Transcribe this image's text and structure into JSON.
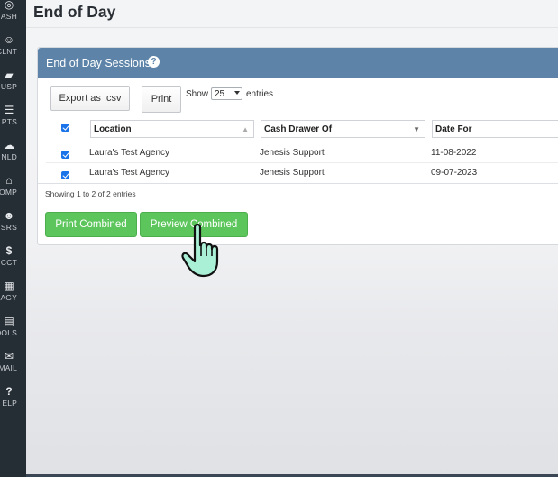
{
  "sidebar": {
    "items": [
      {
        "label": "ASH",
        "icon": "dashboard-icon",
        "glyph": "◎"
      },
      {
        "label": "CLNT",
        "icon": "smiley-icon",
        "glyph": "☺"
      },
      {
        "label": "USP",
        "icon": "note-icon",
        "glyph": "▰"
      },
      {
        "label": "PTS",
        "icon": "list-icon",
        "glyph": "☰"
      },
      {
        "label": "NLD",
        "icon": "cloud-download-icon",
        "glyph": "☁"
      },
      {
        "label": "OMP",
        "icon": "bank-icon",
        "glyph": "⌂"
      },
      {
        "label": "SRS",
        "icon": "users-icon",
        "glyph": "☻"
      },
      {
        "label": "CCT",
        "icon": "dollar-icon",
        "glyph": "$"
      },
      {
        "label": "AGY",
        "icon": "building-icon",
        "glyph": "▦"
      },
      {
        "label": "OOLS",
        "icon": "calculator-icon",
        "glyph": "▤"
      },
      {
        "label": "MAIL",
        "icon": "envelope-icon",
        "glyph": "✉"
      },
      {
        "label": "ELP",
        "icon": "question-icon",
        "glyph": "?"
      }
    ]
  },
  "header": {
    "title": "End of Day"
  },
  "panel": {
    "title": "End of Day Sessions",
    "help_glyph": "?",
    "export_label": "Export as .csv",
    "print_label": "Print",
    "show_label": "Show",
    "entries_value": "25",
    "entries_label": "entries",
    "columns": [
      "Location",
      "Cash Drawer Of",
      "Date For"
    ],
    "rows": [
      {
        "location": "Laura's Test Agency",
        "drawer": "Jenesis Support",
        "date": "11-08-2022"
      },
      {
        "location": "Laura's Test Agency",
        "drawer": "Jenesis Support",
        "date": "09-07-2023"
      }
    ],
    "info": "Showing 1 to 2 of 2 entries",
    "print_combined_label": "Print Combined",
    "preview_combined_label": "Preview Combined"
  },
  "colors": {
    "sidebar": "#262e35",
    "panel_header": "#5d84a8",
    "green_button": "#5cc65c",
    "checkbox": "#1a73e8"
  }
}
